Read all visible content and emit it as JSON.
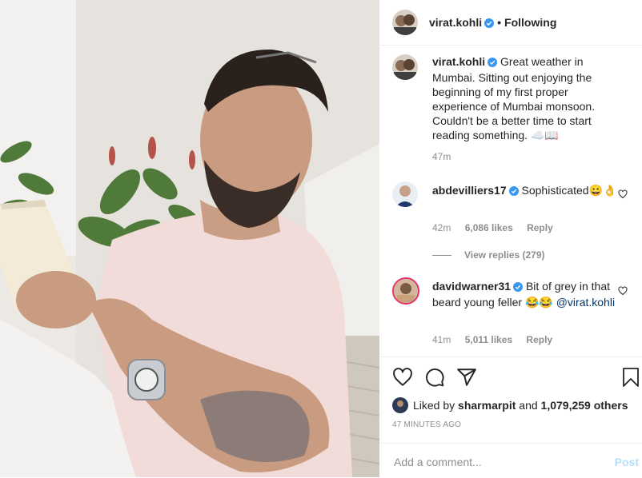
{
  "header": {
    "username": "virat.kohli",
    "separator": "•",
    "follow_state": "Following"
  },
  "caption": {
    "username": "virat.kohli",
    "text": "Great weather in Mumbai. Sitting out enjoying the beginning of my first proper experience of Mumbai monsoon. Couldn't be a better time to start reading something. ☁️📖",
    "time": "47m"
  },
  "comments": [
    {
      "username": "abdevilliers17",
      "text": "Sophisticated😀👌",
      "time": "42m",
      "likes": "6,086 likes",
      "reply": "Reply",
      "view_replies": "View replies (279)"
    },
    {
      "username": "davidwarner31",
      "text": "Bit of grey in that beard young feller 😂😂",
      "mention": "@virat.kohli",
      "time": "41m",
      "likes": "5,011 likes",
      "reply": "Reply"
    }
  ],
  "likes": {
    "prefix": "Liked by",
    "user": "sharmarpit",
    "middle": "and",
    "others": "1,079,259 others"
  },
  "timestamp": "47 MINUTES AGO",
  "add_comment": {
    "placeholder": "Add a comment...",
    "post_label": "Post"
  },
  "icons": [
    "verified-icon",
    "heart-icon",
    "comment-icon",
    "share-icon",
    "bookmark-icon"
  ],
  "colors": {
    "verified": "#3897f0",
    "post_disabled": "#b2dffc",
    "link": "#00376b",
    "meta": "#8e8e8e"
  }
}
